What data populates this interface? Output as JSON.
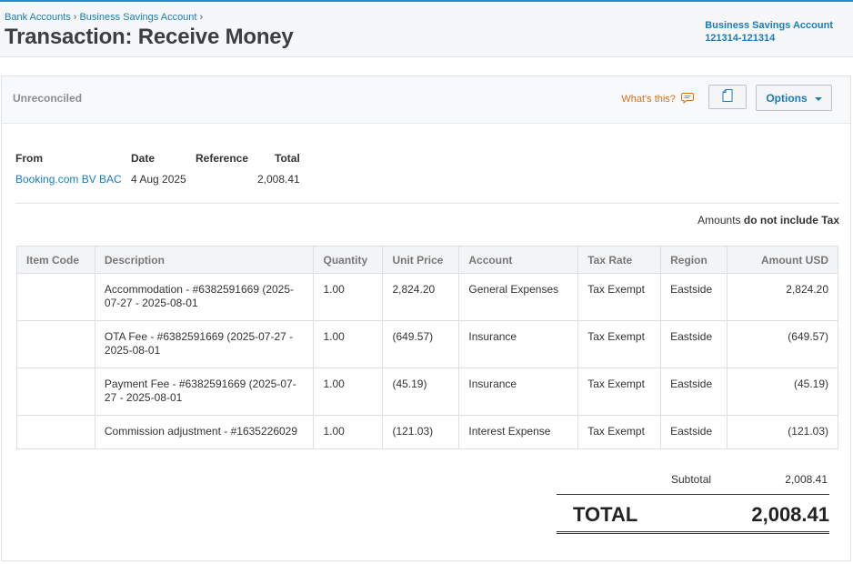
{
  "breadcrumb": [
    "Bank Accounts",
    "Business Savings Account"
  ],
  "title": "Transaction: Receive Money",
  "account": {
    "name": "Business Savings Account",
    "number": "121314-121314"
  },
  "status": "Unreconciled",
  "whats_this": "What's this?",
  "options_label": "Options",
  "summary": {
    "from_label": "From",
    "date_label": "Date",
    "reference_label": "Reference",
    "total_label": "Total",
    "from": "Booking.com BV BAC",
    "date": "4 Aug 2025",
    "reference": "",
    "total": "2,008.41"
  },
  "tax_note": {
    "prefix": "Amounts ",
    "bold": "do not include Tax"
  },
  "table": {
    "headers": [
      "Item Code",
      "Description",
      "Quantity",
      "Unit Price",
      "Account",
      "Tax Rate",
      "Region",
      "Amount USD"
    ],
    "rows": [
      {
        "item_code": "",
        "description": "Accommodation - #6382591669 (2025-07-27 - 2025-08-01",
        "quantity": "1.00",
        "unit_price": "2,824.20",
        "account": "General Expenses",
        "tax_rate": "Tax Exempt",
        "region": "Eastside",
        "amount": "2,824.20"
      },
      {
        "item_code": "",
        "description": "OTA Fee - #6382591669 (2025-07-27 - 2025-08-01",
        "quantity": "1.00",
        "unit_price": "(649.57)",
        "account": "Insurance",
        "tax_rate": "Tax Exempt",
        "region": "Eastside",
        "amount": "(649.57)"
      },
      {
        "item_code": "",
        "description": "Payment Fee - #6382591669 (2025-07-27 - 2025-08-01",
        "quantity": "1.00",
        "unit_price": "(45.19)",
        "account": "Insurance",
        "tax_rate": "Tax Exempt",
        "region": "Eastside",
        "amount": "(45.19)"
      },
      {
        "item_code": "",
        "description": "Commission adjustment - #1635226029",
        "quantity": "1.00",
        "unit_price": "(121.03)",
        "account": "Interest Expense",
        "tax_rate": "Tax Exempt",
        "region": "Eastside",
        "amount": "(121.03)"
      }
    ]
  },
  "totals": {
    "subtotal_label": "Subtotal",
    "subtotal": "2,008.41",
    "total_label": "TOTAL",
    "total": "2,008.41"
  },
  "colors": {
    "accent": "#1a7db8",
    "topbar": "#1e8fd1",
    "help": "#d86f16"
  },
  "icons": {
    "copy": "copy-icon",
    "help": "speech-bubble-icon",
    "options": "chevron-down-icon"
  }
}
